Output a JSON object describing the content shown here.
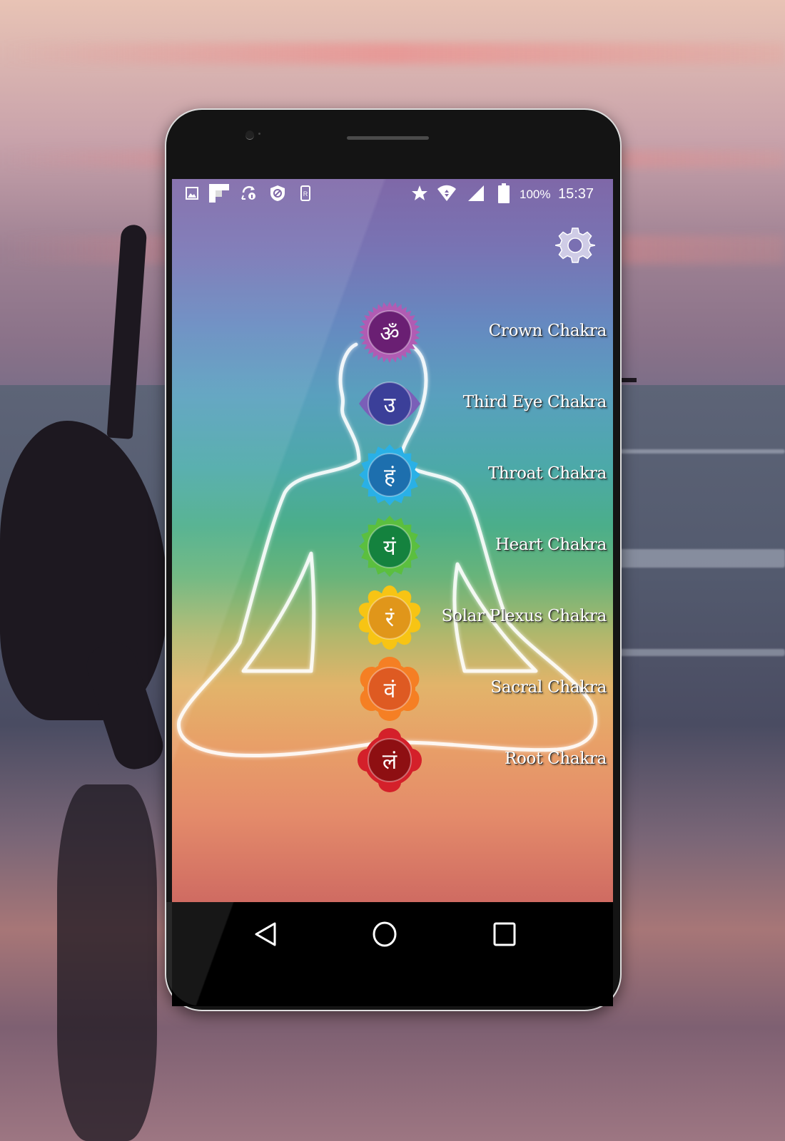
{
  "status_bar": {
    "left_icons": [
      "gallery-icon",
      "flipboard-icon",
      "sync-info-icon",
      "shield-block-icon",
      "r-phone-icon"
    ],
    "right_icons": [
      "star-icon",
      "wifi-icon",
      "signal-icon",
      "battery-icon"
    ],
    "battery": "100%",
    "time": "15:37"
  },
  "app": {
    "settings_icon": "gear-icon",
    "chakras": [
      {
        "name": "Crown Chakra",
        "symbol": "ॐ",
        "color": "#6a1f73",
        "petal_color": "#b05cb3"
      },
      {
        "name": "Third Eye Chakra",
        "symbol": "उ",
        "color": "#3b3f99",
        "petal_color": "#7a5fb8"
      },
      {
        "name": "Throat Chakra",
        "symbol": "हं",
        "color": "#1d6fae",
        "petal_color": "#2ab0e6"
      },
      {
        "name": "Heart Chakra",
        "symbol": "यं",
        "color": "#14823e",
        "petal_color": "#5bbf3f"
      },
      {
        "name": "Solar Plexus Chakra",
        "symbol": "रं",
        "color": "#e0961a",
        "petal_color": "#f7c414"
      },
      {
        "name": "Sacral Chakra",
        "symbol": "वं",
        "color": "#de5a22",
        "petal_color": "#f57f24"
      },
      {
        "name": "Root Chakra",
        "symbol": "लं",
        "color": "#8e0f12",
        "petal_color": "#d4202a"
      }
    ]
  },
  "nav_bar": {
    "back": "back-icon",
    "home": "home-icon",
    "recents": "recents-icon"
  }
}
